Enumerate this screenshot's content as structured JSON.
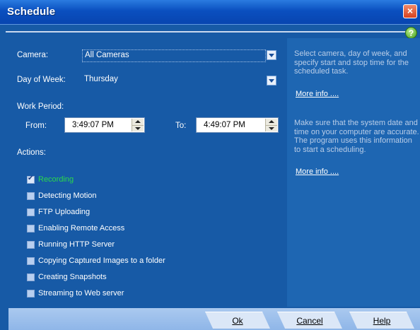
{
  "window": {
    "title": "Schedule",
    "close_glyph": "×"
  },
  "help_glyph": "?",
  "camera": {
    "label": "Camera:",
    "value": "All Cameras"
  },
  "day_of_week": {
    "label": "Day of Week:",
    "value": "Thursday"
  },
  "work_period": {
    "label": "Work Period:",
    "from_label": "From:",
    "from_value": "3:49:07 PM",
    "to_label": "To:",
    "to_value": "4:49:07 PM"
  },
  "actions": {
    "label": "Actions:",
    "items": [
      {
        "label": "Recording",
        "checked": true
      },
      {
        "label": "Detecting Motion",
        "checked": false
      },
      {
        "label": "FTP Uploading",
        "checked": false
      },
      {
        "label": "Enabling Remote Access",
        "checked": false
      },
      {
        "label": "Running HTTP Server",
        "checked": false
      },
      {
        "label": "Copying Captured Images to a folder",
        "checked": false
      },
      {
        "label": "Creating Snapshots",
        "checked": false
      },
      {
        "label": "Streaming to Web server",
        "checked": false
      }
    ]
  },
  "side_info": {
    "text1": "Select camera, day of week, and specify start and stop time for the scheduled task.",
    "more1": "More info ....",
    "text2": "Make sure that the system date and time on your computer are accurate. The program uses this information to start a scheduling.",
    "more2": "More info ...."
  },
  "buttons": {
    "ok": "Ok",
    "cancel": "Cancel",
    "help": "Help"
  }
}
